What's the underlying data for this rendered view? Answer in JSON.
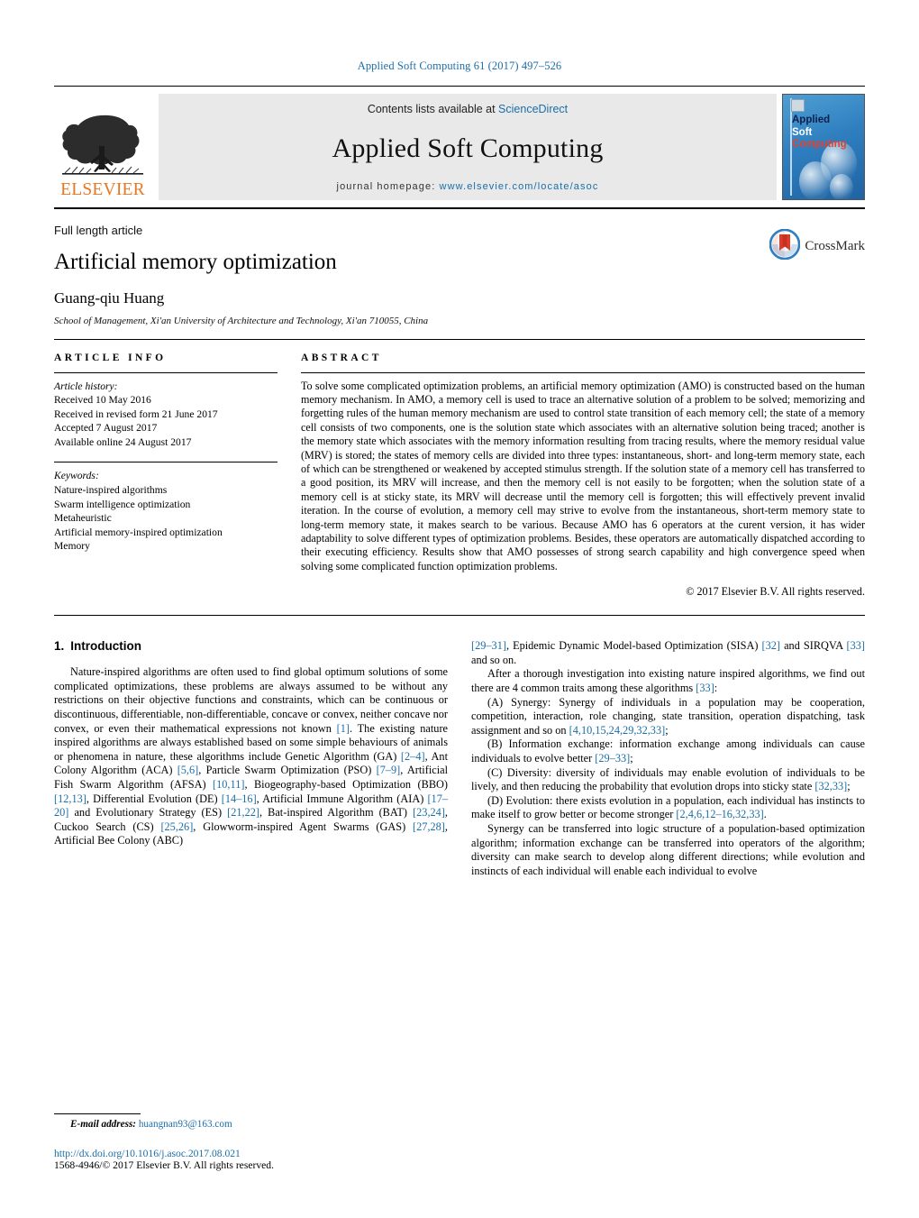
{
  "running_head": "Applied Soft Computing 61 (2017) 497–526",
  "masthead": {
    "publisher_name": "ELSEVIER",
    "contents_prefix": "Contents lists available at ",
    "contents_link": "ScienceDirect",
    "journal_title": "Applied Soft Computing",
    "homepage_prefix": "journal homepage: ",
    "homepage_url": "www.elsevier.com/locate/asoc",
    "cover": {
      "line1": "Applied",
      "line2": "Soft",
      "line3": "Computing"
    }
  },
  "title_block": {
    "article_type": "Full length article",
    "title": "Artificial memory optimization",
    "author": "Guang-qiu Huang",
    "affiliation": "School of Management, Xi'an University of Architecture and Technology, Xi'an 710055, China",
    "crossmark_label": "CrossMark"
  },
  "article_info": {
    "heading": "ARTICLE INFO",
    "history_label": "Article history:",
    "history": [
      "Received 10 May 2016",
      "Received in revised form 21 June 2017",
      "Accepted 7 August 2017",
      "Available online 24 August 2017"
    ],
    "keywords_label": "Keywords:",
    "keywords": [
      "Nature-inspired algorithms",
      "Swarm intelligence optimization",
      "Metaheuristic",
      "Artificial memory-inspired optimization",
      "Memory"
    ]
  },
  "abstract": {
    "heading": "ABSTRACT",
    "text": "To solve some complicated optimization problems, an artificial memory optimization (AMO) is constructed based on the human memory mechanism. In AMO, a memory cell is used to trace an alternative solution of a problem to be solved; memorizing and forgetting rules of the human memory mechanism are used to control state transition of each memory cell; the state of a memory cell consists of two components, one is the solution state which associates with an alternative solution being traced; another is the memory state which associates with the memory information resulting from tracing results, where the memory residual value (MRV) is stored; the states of memory cells are divided into three types: instantaneous, short- and long-term memory state, each of which can be strengthened or weakened by accepted stimulus strength. If the solution state of a memory cell has transferred to a good position, its MRV will increase, and then the memory cell is not easily to be forgotten; when the solution state of a memory cell is at sticky state, its MRV will decrease until the memory cell is forgotten; this will effectively prevent invalid iteration. In the course of evolution, a memory cell may strive to evolve from the instantaneous, short-term memory state to long-term memory state, it makes search to be various. Because AMO has 6 operators at the curent version, it has wider adaptability to solve different types of optimization problems. Besides, these operators are automatically dispatched according to their executing efficiency. Results show that AMO possesses of strong search capability and high convergence speed when solving some complicated function optimization problems.",
    "copyright": "© 2017 Elsevier B.V. All rights reserved."
  },
  "introduction": {
    "number": "1.",
    "title": "Introduction",
    "left_paragraphs": [
      "Nature-inspired algorithms are often used to find global optimum solutions of some complicated optimizations, these problems are always assumed to be without any restrictions on their objective functions and constraints, which can be continuous or discontinuous, differentiable, non-differentiable, concave or convex, neither concave nor convex, or even their mathematical expressions not known [1]. The existing nature inspired algorithms are always established based on some simple behaviours of animals or phenomena in nature, these algorithms include Genetic Algorithm (GA) [2–4], Ant Colony Algorithm (ACA) [5,6], Particle Swarm Optimization (PSO) [7–9], Artificial Fish Swarm Algorithm (AFSA) [10,11], Biogeography-based Optimization (BBO) [12,13], Differential Evolution (DE) [14–16], Artificial Immune Algorithm (AIA) [17–20] and Evolutionary Strategy (ES) [21,22], Bat-inspired Algorithm (BAT) [23,24], Cuckoo Search (CS) [25,26], Glowworm-inspired Agent Swarms (GAS) [27,28], Artificial Bee Colony (ABC)"
    ],
    "right_paragraphs": [
      "[29–31], Epidemic Dynamic Model-based Optimization (SISA) [32] and SIRQVA [33] and so on.",
      "After a thorough investigation into existing nature inspired algorithms, we find out there are 4 common traits among these algorithms [33]:",
      "(A) Synergy: Synergy of individuals in a population may be cooperation, competition, interaction, role changing, state transition, operation dispatching, task assignment and so on [4,10,15,24,29,32,33];",
      "(B) Information exchange: information exchange among individuals can cause individuals to evolve better [29–33];",
      "(C) Diversity: diversity of individuals may enable evolution of individuals to be lively, and then reducing the probability that evolution drops into sticky state [32,33];",
      "(D) Evolution: there exists evolution in a population, each individual has instincts to make itself to grow better or become stronger [2,4,6,12–16,32,33].",
      "Synergy can be transferred into logic structure of a population-based optimization algorithm; information exchange can be transferred into operators of the algorithm; diversity can make search to develop along different directions; while evolution and instincts of each individual will enable each individual to evolve"
    ]
  },
  "footer": {
    "email_label": "E-mail address:",
    "email": "huangnan93@163.com",
    "doi": "http://dx.doi.org/10.1016/j.asoc.2017.08.021",
    "issn_line": "1568-4946/© 2017 Elsevier B.V. All rights reserved."
  },
  "colors": {
    "link_blue": "#1a6ea8",
    "elsevier_orange": "#e87722",
    "band_gray": "#e9e9e9"
  }
}
